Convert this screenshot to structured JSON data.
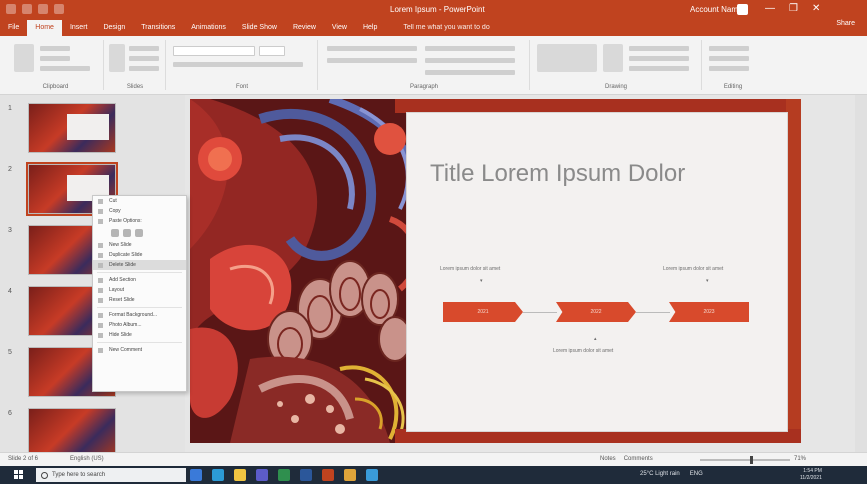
{
  "app": {
    "title": "Lorem Ipsum - PowerPoint",
    "user": "Account Name",
    "window_controls": [
      "—",
      "❐",
      "✕"
    ],
    "accent": "#c0431f"
  },
  "ribbon": {
    "tabs": [
      "File",
      "Home",
      "Insert",
      "Design",
      "Transitions",
      "Animations",
      "Slide Show",
      "Review",
      "View",
      "Help",
      "Tell me what you want to do"
    ],
    "active_tab": 1,
    "share": "Share",
    "groups": [
      "Clipboard",
      "Slides",
      "Font",
      "Paragraph",
      "Drawing",
      "Editing"
    ]
  },
  "thumbnails": [
    {
      "num": "1",
      "selected": false
    },
    {
      "num": "2",
      "selected": true
    },
    {
      "num": "3",
      "selected": false
    },
    {
      "num": "4",
      "selected": false
    },
    {
      "num": "5",
      "selected": false
    },
    {
      "num": "6",
      "selected": false
    }
  ],
  "context_menu": {
    "items": [
      "Cut",
      "Copy",
      "Paste Options:",
      "New Slide",
      "Duplicate Slide",
      "Delete Slide",
      "Add Section",
      "Layout",
      "Reset Slide",
      "Format Background...",
      "Photo Album...",
      "Hide Slide",
      "New Comment"
    ],
    "highlighted": "Delete Slide"
  },
  "slide": {
    "title": "Title Lorem Ipsum Dolor",
    "label_left": "Lorem ipsum dolor sit amet",
    "label_right": "Lorem ipsum dolor sit amet",
    "label_bottom": "Lorem ipsum dolor sit amet",
    "pills": [
      "2021",
      "2022",
      "2023"
    ],
    "pill_color": "#d84a2c",
    "background_color": "#5a1616"
  },
  "statusbar": {
    "slide_info": "Slide 2 of 6",
    "notes": "English (US)",
    "right_items": [
      "Notes",
      "Comments",
      "—",
      "+",
      "71%"
    ],
    "zoom_fraction": 0.55
  },
  "taskbar": {
    "search_placeholder": "Type here to search",
    "tray": [
      "25°C Light rain",
      "ENG"
    ],
    "time": "1:54 PM",
    "date": "11/2/2021"
  }
}
